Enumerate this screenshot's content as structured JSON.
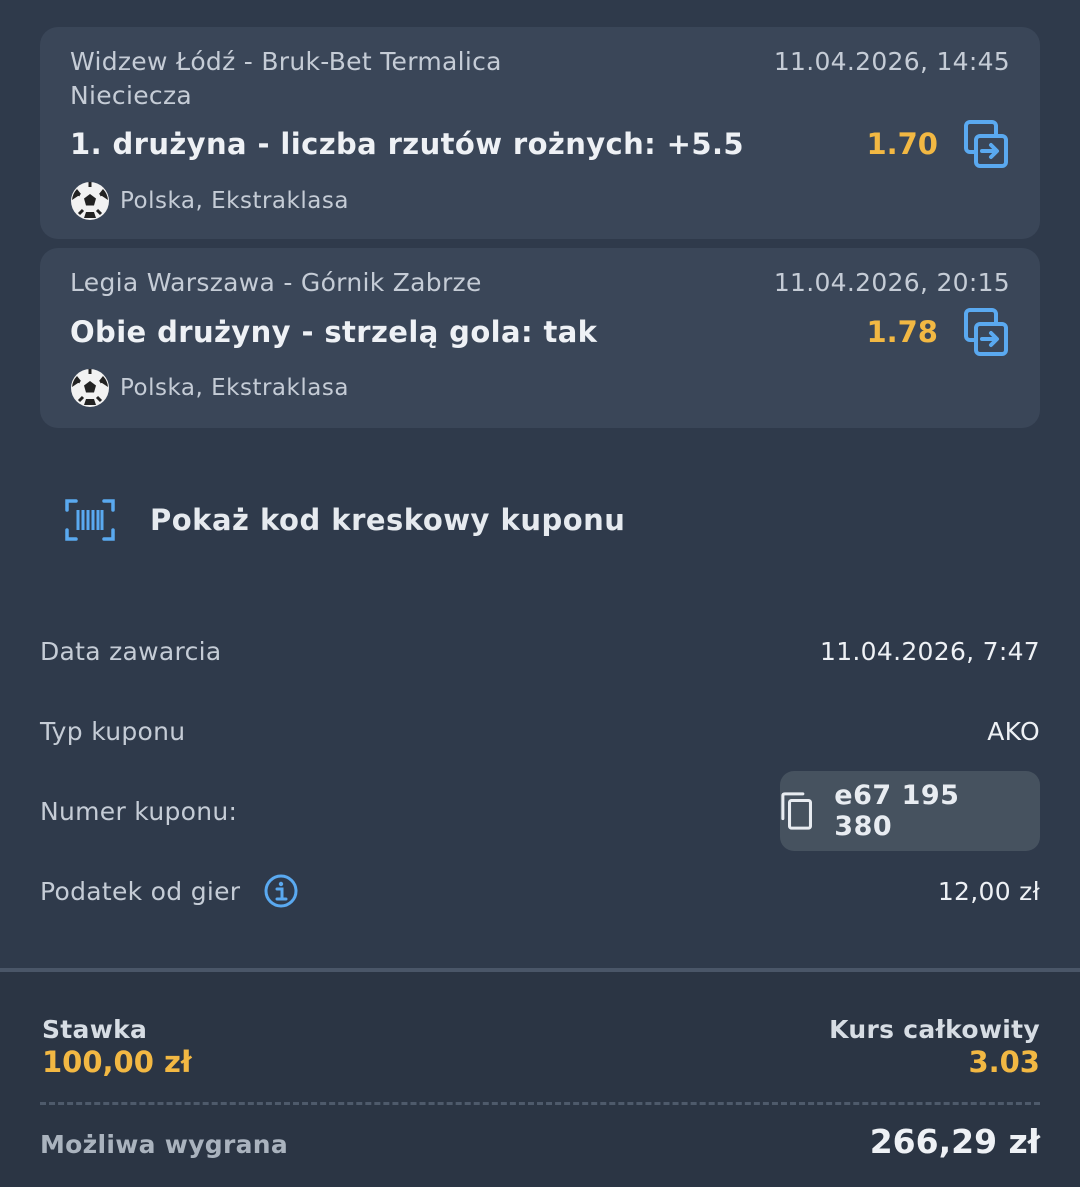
{
  "bets": [
    {
      "match": "Widzew Łódź - Bruk-Bet Termalica Nieciecza",
      "datetime": "11.04.2026, 14:45",
      "pick": "1. drużyna - liczba rzutów rożnych: +5.5",
      "odds": "1.70",
      "league": "Polska, Ekstraklasa"
    },
    {
      "match": "Legia Warszawa - Górnik Zabrze",
      "datetime": "11.04.2026, 20:15",
      "pick": "Obie drużyny - strzelą gola: tak",
      "odds": "1.78",
      "league": "Polska, Ekstraklasa"
    }
  ],
  "barcode": {
    "label": "Pokaż kod kreskowy kuponu"
  },
  "details": {
    "date_label": "Data zawarcia",
    "date_value": "11.04.2026, 7:47",
    "type_label": "Typ kuponu",
    "type_value": "AKO",
    "number_label": "Numer kuponu:",
    "number_value": "e67 195 380",
    "tax_label": "Podatek od gier",
    "tax_value": "12,00 zł"
  },
  "summary": {
    "stake_label": "Stawka",
    "stake_value": "100,00 zł",
    "total_odds_label": "Kurs całkowity",
    "total_odds_value": "3.03",
    "win_label": "Możliwa wygrana",
    "win_value": "266,29 zł"
  },
  "colors": {
    "background": "#2f3a4b",
    "card": "#3a4658",
    "accent_odds": "#f2b843",
    "icon_blue": "#5aa9f0"
  },
  "icons": [
    "soccer-ball-icon",
    "swap-icon",
    "barcode-icon",
    "copy-icon",
    "info-icon"
  ]
}
